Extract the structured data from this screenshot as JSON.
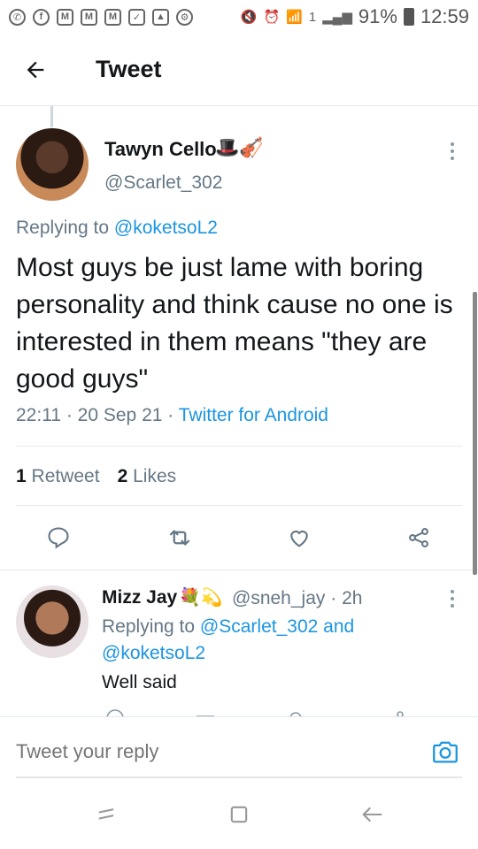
{
  "status_bar": {
    "battery": "91%",
    "time": "12:59",
    "sim": "1"
  },
  "header": {
    "title": "Tweet"
  },
  "tweet": {
    "author_name": "Tawyn Cello",
    "author_emoji": "🎩🎻",
    "handle": "@Scarlet_302",
    "replying_prefix": "Replying to ",
    "replying_to": "@koketsoL2",
    "text": "Most guys be just lame with boring personality and think cause no one is interested in them means \"they are good guys\"",
    "time": "22:11",
    "date": "20 Sep 21",
    "source": "Twitter for Android",
    "retweet_count": "1",
    "retweet_label": "Retweet",
    "likes_count": "2",
    "likes_label": "Likes"
  },
  "reply": {
    "author_name": "Mizz Jay",
    "author_emoji": "💐💫",
    "handle": "@sneh_jay",
    "age": "2h",
    "replying_prefix": "Replying to ",
    "replying_to_1": "@Scarlet_302",
    "and_word": " and ",
    "replying_to_2": "@koketsoL2",
    "text": "Well said"
  },
  "compose": {
    "placeholder": "Tweet your reply"
  },
  "colors": {
    "link": "#1b95e0",
    "secondary_text": "#657786",
    "divider": "#e1e8ed"
  }
}
